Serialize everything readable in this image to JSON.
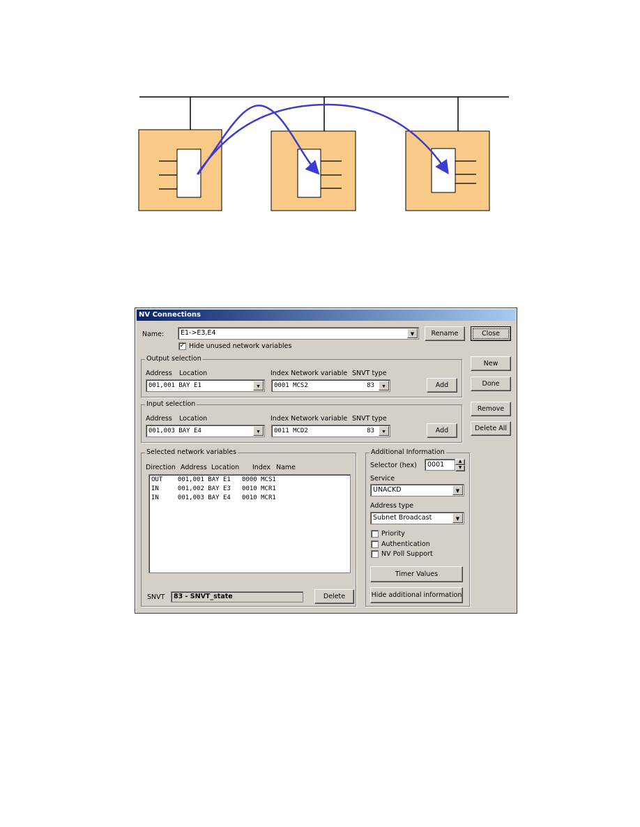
{
  "colors": {
    "node_fill": "#f9c987",
    "arrow": "#3c3cd2",
    "titlebar": "#0a246a"
  },
  "dialog": {
    "title": "NV Connections",
    "name_label": "Name:",
    "name_value": "E1->E3,E4",
    "rename": "Rename",
    "close": "Close",
    "hide_unused": "Hide unused network variables",
    "hide_unused_checked": true,
    "new": "New",
    "done": "Done",
    "remove": "Remove",
    "delete_all": "Delete All",
    "output": {
      "title": "Output selection",
      "address_hdr": "Address",
      "location_hdr": "Location",
      "index_hdr": "Index Network variable",
      "snvt_hdr": "SNVT type",
      "address_value": "001,001 BAY E1",
      "nv_value": "0001 MCS2",
      "snvt_value": "83",
      "add": "Add"
    },
    "input": {
      "title": "Input selection",
      "address_hdr": "Address",
      "location_hdr": "Location",
      "index_hdr": "Index Network variable",
      "snvt_hdr": "SNVT type",
      "address_value": "001,003 BAY E4",
      "nv_value": "0011 MCD2",
      "snvt_value": "83",
      "add": "Add"
    },
    "selected": {
      "title": "Selected network variables",
      "headers": [
        "Direction",
        "Address",
        "Location",
        "Index",
        "Name"
      ],
      "rows": [
        "OUT    001,001 BAY E1   0000 MCS1",
        "IN     001,002 BAY E3   0010 MCR1",
        "IN     001,003 BAY E4   0010 MCR1"
      ],
      "snvt_label": "SNVT",
      "snvt_value": "83 - SNVT_state",
      "delete": "Delete"
    },
    "additional": {
      "title": "Additional Information",
      "selector_label": "Selector (hex)",
      "selector_value": "0001",
      "service_label": "Service",
      "service_value": "UNACKD",
      "address_type_label": "Address type",
      "address_type_value": "Subnet Broadcast",
      "checkboxes": [
        {
          "label": "Priority",
          "checked": false
        },
        {
          "label": "Authentication",
          "checked": false
        },
        {
          "label": "NV Poll Support",
          "checked": false
        }
      ],
      "timer": "Timer Values",
      "hide_info": "Hide additional information"
    }
  }
}
